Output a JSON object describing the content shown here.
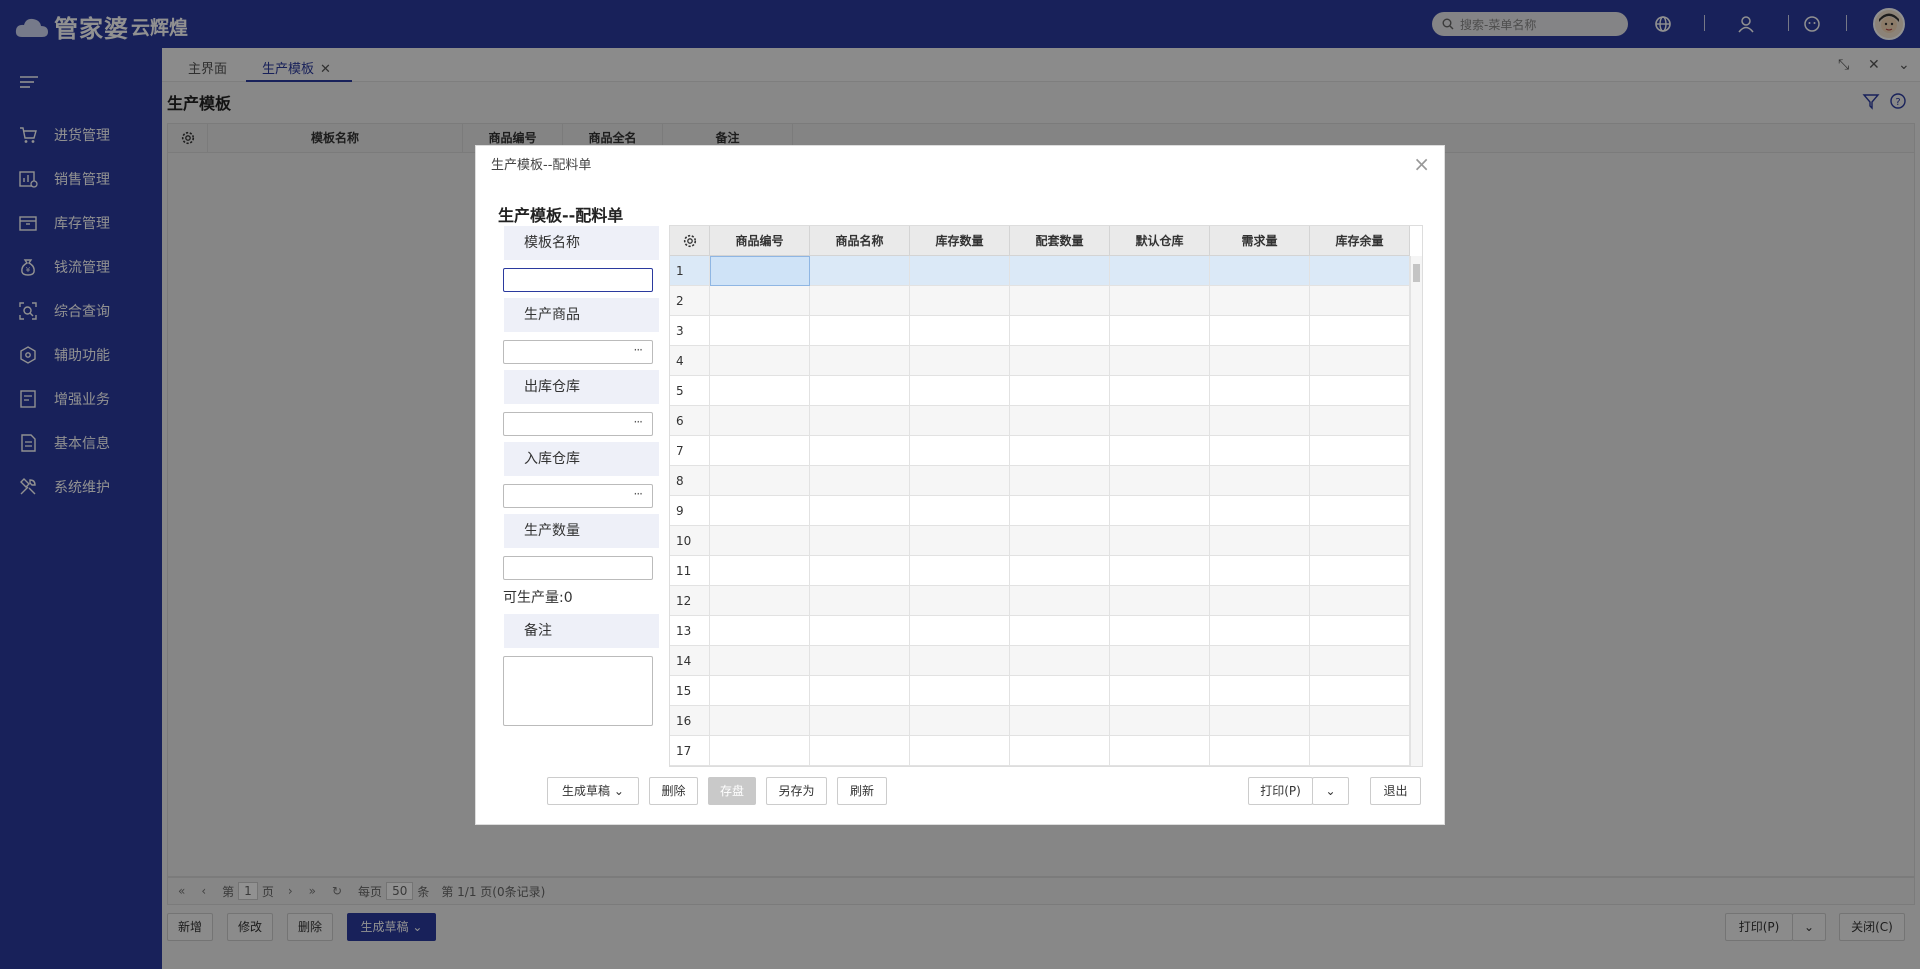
{
  "app": {
    "brand": "管家婆",
    "brand_sub": "云辉煌",
    "search_placeholder": "搜索-菜单名称"
  },
  "colors": {
    "primary": "#2b3a9e",
    "selected_cell": "#cfe3f7"
  },
  "sidebar": {
    "items": [
      {
        "label": "进货管理",
        "icon": "cart-icon"
      },
      {
        "label": "销售管理",
        "icon": "sales-chart-icon"
      },
      {
        "label": "库存管理",
        "icon": "box-icon"
      },
      {
        "label": "钱流管理",
        "icon": "money-bag-icon"
      },
      {
        "label": "综合查询",
        "icon": "query-icon"
      },
      {
        "label": "辅助功能",
        "icon": "assist-icon"
      },
      {
        "label": "增强业务",
        "icon": "document-icon"
      },
      {
        "label": "基本信息",
        "icon": "info-doc-icon"
      },
      {
        "label": "系统维护",
        "icon": "tools-icon"
      }
    ]
  },
  "tabs": [
    {
      "label": "主界面",
      "active": false
    },
    {
      "label": "生产模板",
      "active": true
    }
  ],
  "page": {
    "title": "生产模板",
    "columns": [
      "模板名称",
      "商品编号",
      "商品全名",
      "备注"
    ],
    "pager": {
      "prefix": "第",
      "page": "1",
      "page_suffix": "页",
      "per_page_label": "每页",
      "per_page": "50",
      "per_page_suffix": "条",
      "summary": "第 1/1 页(0条记录)"
    },
    "buttons": {
      "add": "新增",
      "edit": "修改",
      "delete": "删除",
      "generate_draft": "生成草稿",
      "print": "打印(P)",
      "close": "关闭(C)"
    }
  },
  "modal": {
    "title": "生产模板--配料单",
    "form_title": "生产模板--配料单",
    "fields": {
      "template_name": {
        "label": "模板名称",
        "value": ""
      },
      "product": {
        "label": "生产商品",
        "value": ""
      },
      "out_warehouse": {
        "label": "出库仓库",
        "value": ""
      },
      "in_warehouse": {
        "label": "入库仓库",
        "value": ""
      },
      "quantity": {
        "label": "生产数量",
        "value": ""
      },
      "producible": "可生产量:0",
      "remark": {
        "label": "备注",
        "value": ""
      }
    },
    "table": {
      "columns": [
        "商品编号",
        "商品名称",
        "库存数量",
        "配套数量",
        "默认仓库",
        "需求量",
        "库存余量"
      ],
      "row_numbers": [
        "1",
        "2",
        "3",
        "4",
        "5",
        "6",
        "7",
        "8",
        "9",
        "10",
        "11",
        "12",
        "13",
        "14",
        "15",
        "16",
        "17"
      ]
    },
    "buttons": {
      "generate_draft": "生成草稿",
      "delete": "删除",
      "save": "存盘",
      "save_as": "另存为",
      "refresh": "刷新",
      "print": "打印(P)",
      "exit": "退出"
    }
  }
}
